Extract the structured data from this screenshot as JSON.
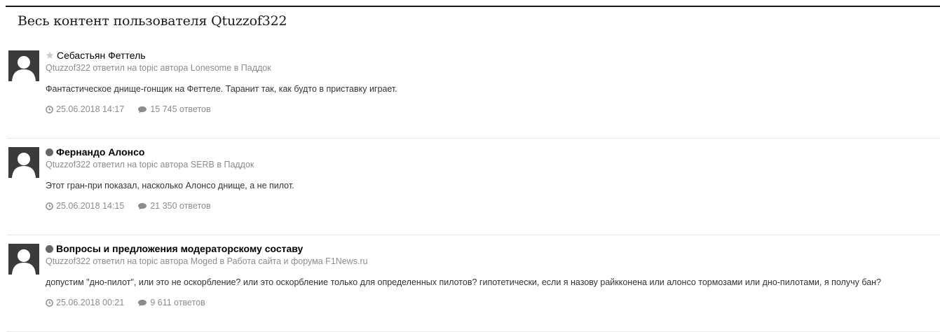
{
  "page": {
    "title": "Весь контент пользователя Qtuzzof322"
  },
  "items": [
    {
      "status": "star",
      "title": "Себастьян Феттель",
      "meta": {
        "author": "Qtuzzof322",
        "action": "ответил на topic автора",
        "topic_author": "Lonesome",
        "in_word": "в",
        "forum": "Паддок"
      },
      "snippet": "Фантастическое днище-гонщик на Феттеле. Таранит так, как будто в приставку играет.",
      "date": "25.06.2018 14:17",
      "replies": "15 745 ответов"
    },
    {
      "status": "dot",
      "title": "Фернандо Алонсо",
      "meta": {
        "author": "Qtuzzof322",
        "action": "ответил на topic автора",
        "topic_author": "SERB",
        "in_word": "в",
        "forum": "Паддок"
      },
      "snippet": "Этот гран-при показал, насколько Алонсо днище, а не пилот.",
      "date": "25.06.2018 14:15",
      "replies": "21 350 ответов"
    },
    {
      "status": "dot",
      "title": "Вопросы и предложения модераторскому составу",
      "meta": {
        "author": "Qtuzzof322",
        "action": "ответил на topic автора",
        "topic_author": "Moged",
        "in_word": "в",
        "forum": "Работа сайта и форума F1News.ru"
      },
      "snippet": "допустим \"дно-пилот\", или это не оскорбление? или это оскорбление только для определенных пилотов? гипотетически, если я назову райкконена или алонсо тормозами или дно-пилотами, я получу бан?",
      "date": "25.06.2018 00:21",
      "replies": "9 611 ответов"
    }
  ],
  "icons": {
    "status_star": "star-icon",
    "status_dot": "unread-dot-icon",
    "date": "clock-icon",
    "replies": "comment-icon"
  },
  "colors": {
    "meta": "#8c8c8c",
    "avatar_bg": "#3b3b3b",
    "dot": "#666666"
  }
}
